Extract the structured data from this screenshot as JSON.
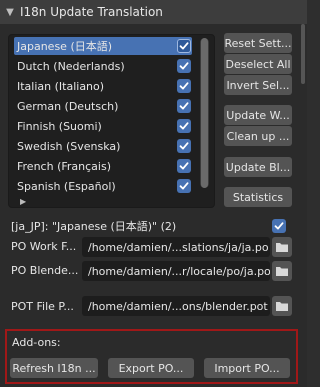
{
  "panel": {
    "title": "I18n Update Translation"
  },
  "languages": [
    {
      "label": "Japanese (日本語)",
      "checked": true,
      "selected": true
    },
    {
      "label": "Dutch (Nederlands)",
      "checked": true,
      "selected": false
    },
    {
      "label": "Italian (Italiano)",
      "checked": true,
      "selected": false
    },
    {
      "label": "German (Deutsch)",
      "checked": true,
      "selected": false
    },
    {
      "label": "Finnish (Suomi)",
      "checked": true,
      "selected": false
    },
    {
      "label": "Swedish (Svenska)",
      "checked": true,
      "selected": false
    },
    {
      "label": "French (Français)",
      "checked": true,
      "selected": false
    },
    {
      "label": "Spanish (Español)",
      "checked": true,
      "selected": false
    }
  ],
  "buttons": {
    "reset": "Reset Sett...",
    "deselect": "Deselect All",
    "invert": "Invert Sel...",
    "update_w": "Update W...",
    "cleanup": "Clean up ...",
    "update_bl": "Update Bl...",
    "statistics": "Statistics"
  },
  "active": {
    "label": "[ja_JP]: \"Japanese (日本語)\" (2)",
    "checked": true
  },
  "fields": {
    "po_work_label": "PO Work F...",
    "po_work_value": "/home/damien/...slations/ja/ja.po",
    "po_blender_label": "PO Blende...",
    "po_blender_value": "/home/damien/...r/locale/po/ja.po",
    "pot_label": "POT File P...",
    "pot_value": "/home/damien/...ons/blender.pot"
  },
  "addons": {
    "label": "Add-ons:",
    "refresh": "Refresh I18n ...",
    "export": "Export PO...",
    "import": "Import PO..."
  }
}
